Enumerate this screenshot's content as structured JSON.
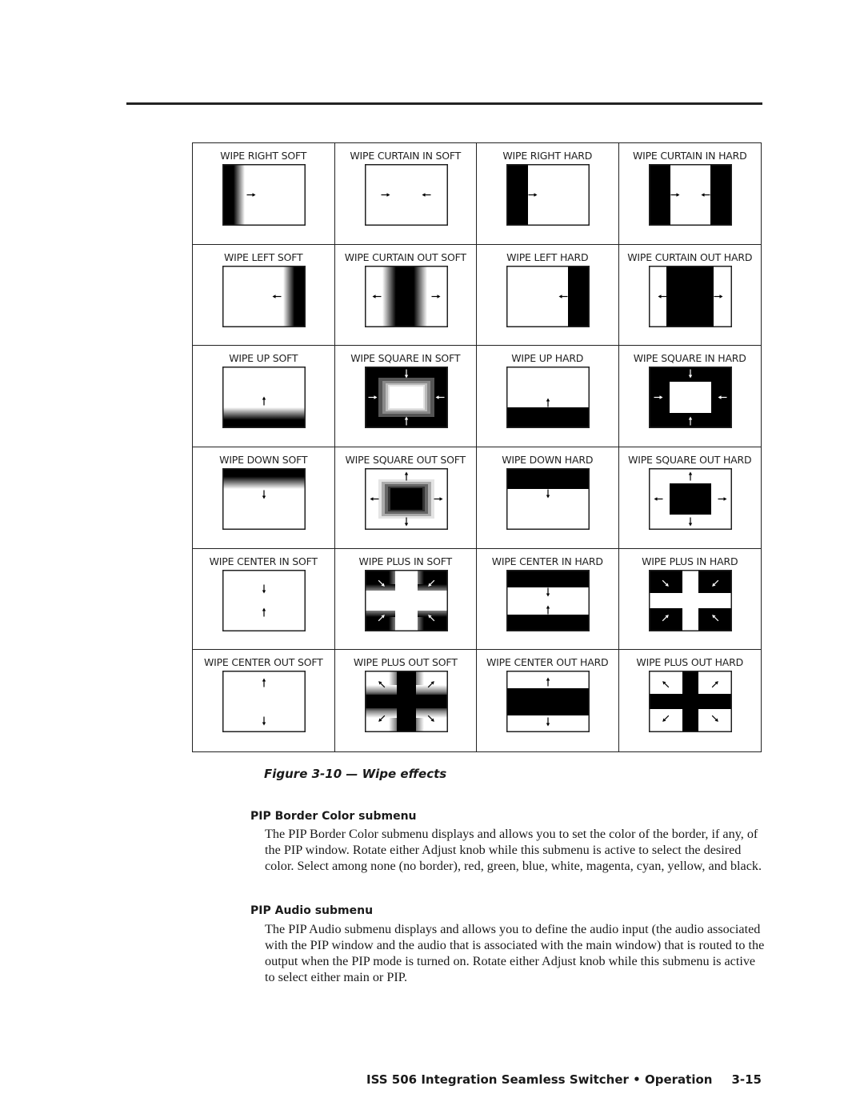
{
  "figure": {
    "cells": [
      {
        "label": "WIPE RIGHT SOFT",
        "type": "right-soft"
      },
      {
        "label": "WIPE CURTAIN IN SOFT",
        "type": "curtain-in-soft"
      },
      {
        "label": "WIPE RIGHT HARD",
        "type": "right-hard"
      },
      {
        "label": "WIPE CURTAIN IN HARD",
        "type": "curtain-in-hard"
      },
      {
        "label": "WIPE LEFT SOFT",
        "type": "left-soft"
      },
      {
        "label": "WIPE CURTAIN OUT SOFT",
        "type": "curtain-out-soft"
      },
      {
        "label": "WIPE LEFT HARD",
        "type": "left-hard"
      },
      {
        "label": "WIPE CURTAIN OUT HARD",
        "type": "curtain-out-hard"
      },
      {
        "label": "WIPE UP SOFT",
        "type": "up-soft"
      },
      {
        "label": "WIPE SQUARE IN SOFT",
        "type": "square-in-soft"
      },
      {
        "label": "WIPE UP HARD",
        "type": "up-hard"
      },
      {
        "label": "WIPE SQUARE IN HARD",
        "type": "square-in-hard"
      },
      {
        "label": "WIPE DOWN SOFT",
        "type": "down-soft"
      },
      {
        "label": "WIPE SQUARE OUT SOFT",
        "type": "square-out-soft"
      },
      {
        "label": "WIPE DOWN HARD",
        "type": "down-hard"
      },
      {
        "label": "WIPE SQUARE OUT HARD",
        "type": "square-out-hard"
      },
      {
        "label": "WIPE CENTER IN SOFT",
        "type": "center-in-soft"
      },
      {
        "label": "WIPE PLUS IN SOFT",
        "type": "plus-in-soft"
      },
      {
        "label": "WIPE CENTER IN HARD",
        "type": "center-in-hard"
      },
      {
        "label": "WIPE PLUS IN HARD",
        "type": "plus-in-hard"
      },
      {
        "label": "WIPE CENTER OUT SOFT",
        "type": "center-out-soft"
      },
      {
        "label": "WIPE PLUS OUT SOFT",
        "type": "plus-out-soft"
      },
      {
        "label": "WIPE CENTER OUT HARD",
        "type": "center-out-hard"
      },
      {
        "label": "WIPE PLUS OUT HARD",
        "type": "plus-out-hard"
      }
    ],
    "caption": "Figure 3-10 — Wipe effects"
  },
  "sections": [
    {
      "heading": "PIP Border Color submenu",
      "body": "The PIP Border Color submenu displays and allows you to set the color of the border, if any, of the PIP window.  Rotate either Adjust knob while this submenu is active to select the desired color.  Select among none (no border), red, green, blue, white, magenta, cyan, yellow, and black."
    },
    {
      "heading": "PIP Audio submenu",
      "body": "The PIP Audio submenu displays and allows you to define the audio input (the audio associated with the PIP window and the audio that is associated with the main window) that is routed to the output when the PIP mode is turned on.  Rotate either Adjust knob while this submenu is active to select either main or PIP."
    }
  ],
  "footer": {
    "title": "ISS 506 Integration Seamless Switcher • Operation",
    "page": "3-15"
  }
}
